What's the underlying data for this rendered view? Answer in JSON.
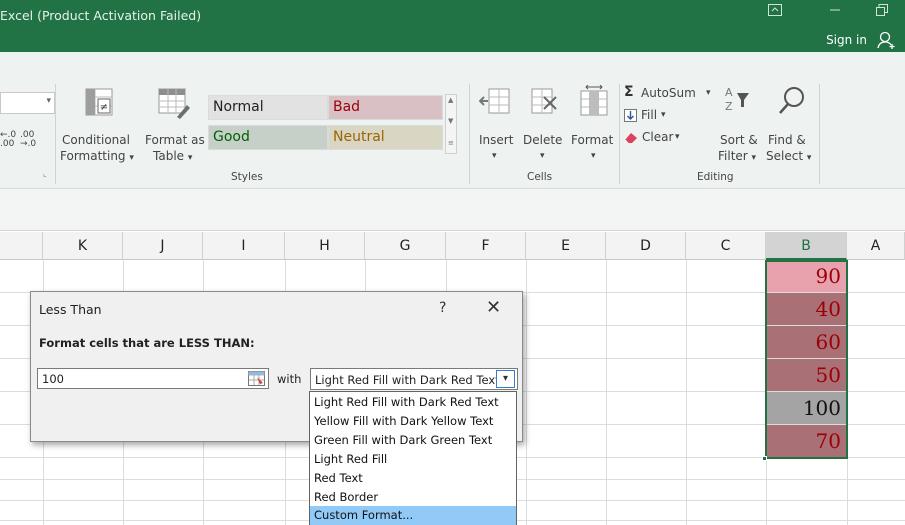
{
  "titlebar": {
    "title": "Excel (Product Activation Failed)",
    "signin": "Sign in",
    "accent": "#217346"
  },
  "ribbon": {
    "number": {
      "increase_decimal": "←.0\n.00",
      "decrease_decimal": ".00\n→.0"
    },
    "conditional_formatting": {
      "line1": "Conditional",
      "line2": "Formatting",
      "caret": "▾"
    },
    "format_as_table": {
      "line1": "Format as",
      "line2": "Table",
      "caret": "▾"
    },
    "styles": {
      "group_label": "Styles",
      "cells": [
        {
          "label": "Normal",
          "bg": "#e2e2e2",
          "color": "#222222"
        },
        {
          "label": "Bad",
          "bg": "#d9c0c5",
          "color": "#9c0006"
        },
        {
          "label": "Good",
          "bg": "#c6d0c8",
          "color": "#006100"
        },
        {
          "label": "Neutral",
          "bg": "#d9d6c4",
          "color": "#9c6500"
        }
      ]
    },
    "cells_group": {
      "group_label": "Cells",
      "insert": "Insert",
      "delete": "Delete",
      "format": "Format"
    },
    "editing_group": {
      "group_label": "Editing",
      "autosum": "AutoSum",
      "fill": "Fill",
      "clear": "Clear",
      "sort_line1": "Sort &",
      "sort_line2": "Filter",
      "find_line1": "Find &",
      "find_line2": "Select"
    }
  },
  "columns": [
    "K",
    "J",
    "I",
    "H",
    "G",
    "F",
    "E",
    "D",
    "C",
    "B",
    "A"
  ],
  "selected_column": "B",
  "cells_b": [
    {
      "value": "90",
      "bg": "#e8a2ad",
      "color": "#9c0006"
    },
    {
      "value": "40",
      "bg": "#a97076",
      "color": "#9c0006"
    },
    {
      "value": "60",
      "bg": "#a97076",
      "color": "#9c0006"
    },
    {
      "value": "50",
      "bg": "#a97076",
      "color": "#9c0006"
    },
    {
      "value": "100",
      "bg": "#a4a4a4",
      "color": "#111111"
    },
    {
      "value": "70",
      "bg": "#a97076",
      "color": "#9c0006"
    }
  ],
  "dialog": {
    "title": "Less Than",
    "help": "?",
    "close": "✕",
    "prompt": "Format cells that are LESS THAN:",
    "value": "100",
    "with_label": "with",
    "selected_format": "Light Red Fill with Dark Red Text",
    "arrow": "▾",
    "options": [
      "Light Red Fill with Dark Red Text",
      "Yellow Fill with Dark Yellow Text",
      "Green Fill with Dark Green Text",
      "Light Red Fill",
      "Red Text",
      "Red Border",
      "Custom Format..."
    ],
    "highlighted_option_index": 6
  }
}
